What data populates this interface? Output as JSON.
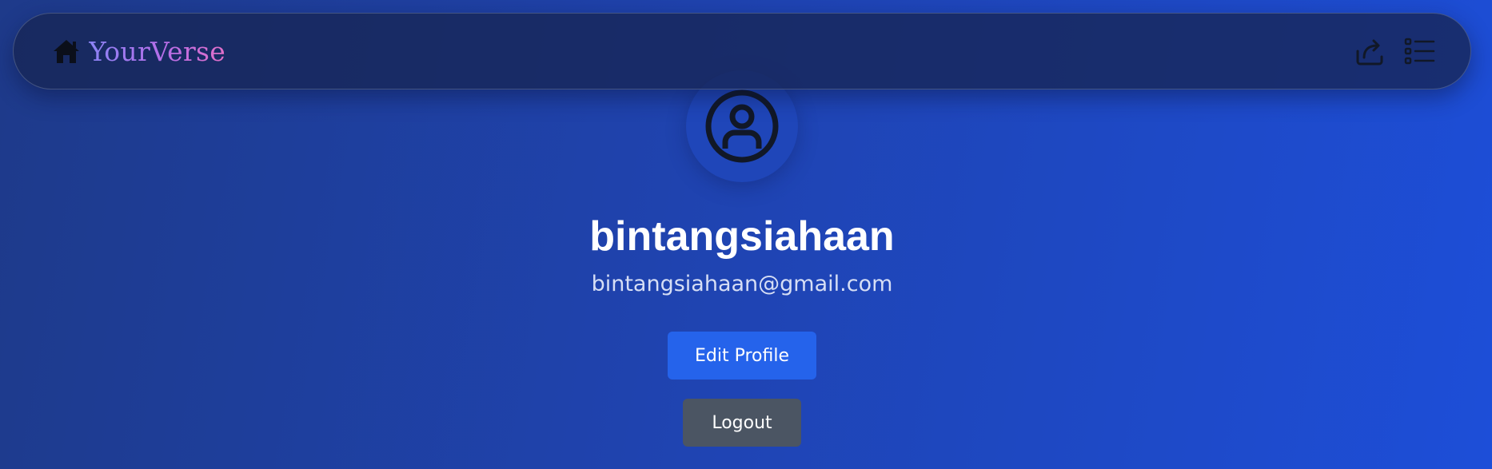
{
  "nav": {
    "brand": "YourVerse",
    "icons": {
      "home": "home-icon",
      "share": "share-icon",
      "menu": "list-menu-icon"
    }
  },
  "profile": {
    "avatar_icon": "user-circle-icon",
    "username": "bintangsiahaan",
    "email": "bintangsiahaan@gmail.com"
  },
  "actions": {
    "edit_label": "Edit Profile",
    "logout_label": "Logout"
  },
  "colors": {
    "background_start": "#1e3a8a",
    "background_end": "#1d4ed8",
    "edit_button": "#2563eb",
    "logout_button": "#4b5563",
    "brand_gradient": [
      "#8b83f5",
      "#e16fc8"
    ]
  }
}
